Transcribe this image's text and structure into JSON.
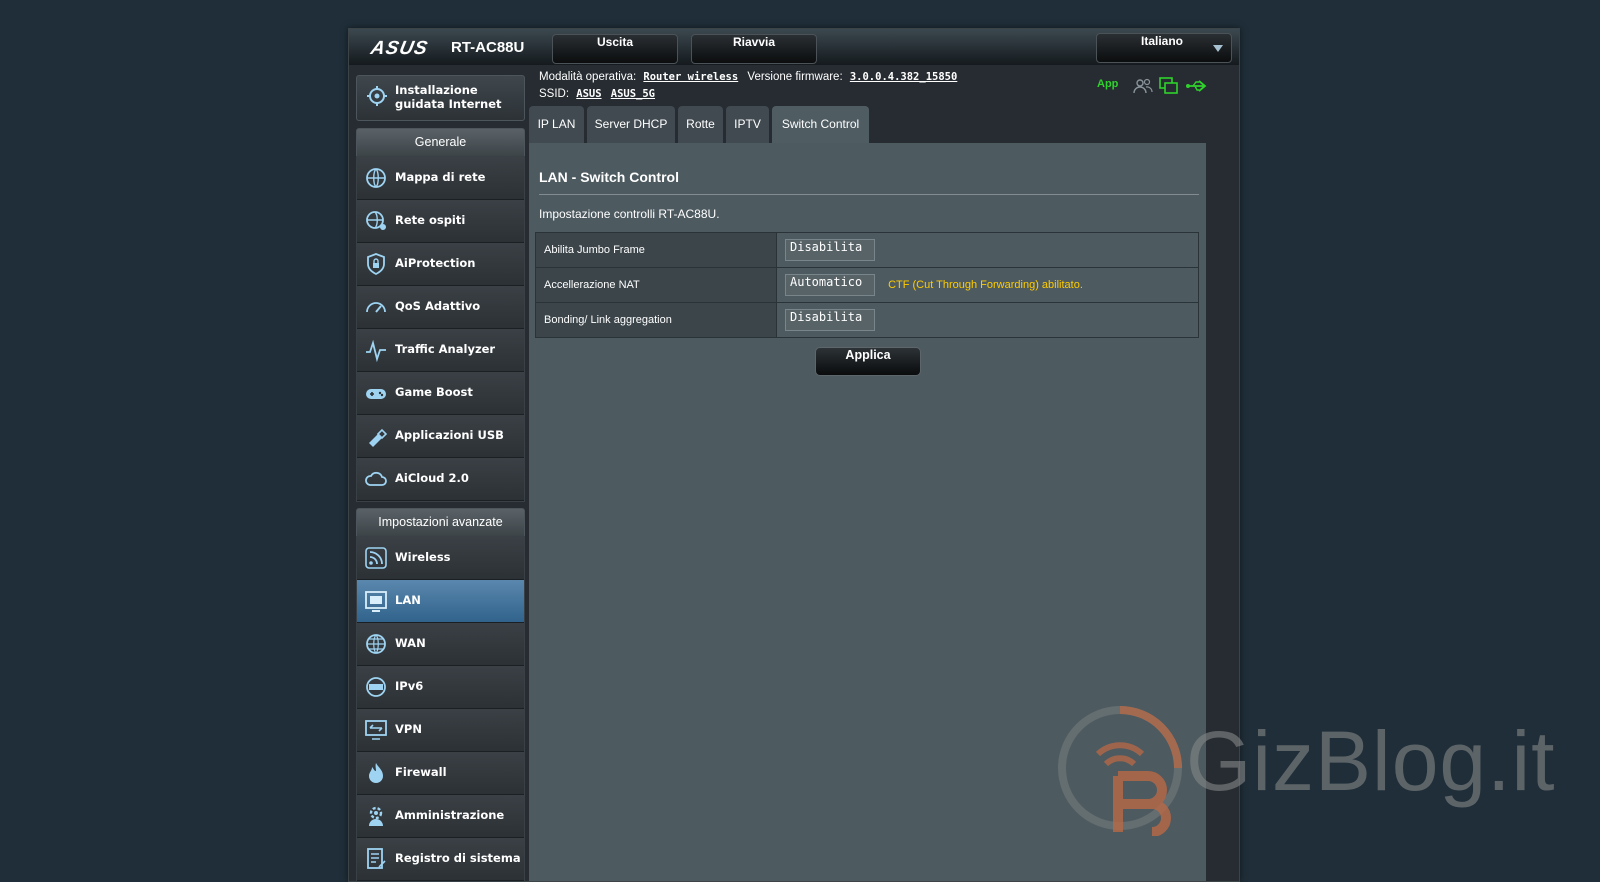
{
  "header": {
    "logo": "ASUS",
    "model": "RT-AC88U",
    "logout_label": "Uscita",
    "reboot_label": "Riavvia",
    "language": "Italiano"
  },
  "status": {
    "mode_label": "Modalità operativa:",
    "mode_value": "Router wireless",
    "firmware_label": "Versione firmware:",
    "firmware_value": "3.0.0.4.382_15850",
    "ssid_label": "SSID:",
    "ssids": [
      "ASUS",
      "ASUS_5G"
    ],
    "app_label": "App",
    "icons": [
      "clients-icon",
      "network-icon",
      "usb-icon"
    ],
    "icon_color": "#2fd22c"
  },
  "sidebar": {
    "qis_label_1": "Installazione",
    "qis_label_2": "guidata Internet",
    "general_header": "Generale",
    "general_items": [
      {
        "label": "Mappa di rete",
        "icon": "globe-network-icon"
      },
      {
        "label": "Rete ospiti",
        "icon": "guest-network-icon"
      },
      {
        "label": "AiProtection",
        "icon": "lock-shield-icon"
      },
      {
        "label": "QoS Adattivo",
        "icon": "gauge-icon"
      },
      {
        "label": "Traffic Analyzer",
        "icon": "pulse-icon"
      },
      {
        "label": "Game Boost",
        "icon": "gamepad-icon"
      },
      {
        "label": "Applicazioni USB",
        "icon": "usb-stick-icon"
      },
      {
        "label": "AiCloud 2.0",
        "icon": "cloud-icon"
      }
    ],
    "advanced_header": "Impostazioni avanzate",
    "advanced_items": [
      {
        "label": "Wireless",
        "icon": "wifi-icon"
      },
      {
        "label": "LAN",
        "icon": "lan-icon",
        "active": true
      },
      {
        "label": "WAN",
        "icon": "globe-icon"
      },
      {
        "label": "IPv6",
        "icon": "ipv6-icon"
      },
      {
        "label": "VPN",
        "icon": "vpn-icon"
      },
      {
        "label": "Firewall",
        "icon": "flame-icon"
      },
      {
        "label": "Amministrazione",
        "icon": "gear-user-icon"
      },
      {
        "label": "Registro di sistema",
        "icon": "log-icon"
      }
    ],
    "active_color": "#31638c"
  },
  "tabs": [
    {
      "label": "IP LAN"
    },
    {
      "label": "Server DHCP"
    },
    {
      "label": "Rotte"
    },
    {
      "label": "IPTV"
    },
    {
      "label": "Switch Control",
      "active": true
    }
  ],
  "content": {
    "title": "LAN - Switch Control",
    "description": "Impostazione controlli RT-AC88U.",
    "rows": [
      {
        "label": "Abilita Jumbo Frame",
        "value": "Disabilita",
        "note": ""
      },
      {
        "label": "Accellerazione NAT",
        "value": "Automatico",
        "note": "CTF (Cut Through Forwarding) abilitato."
      },
      {
        "label": "Bonding/ Link aggregation",
        "value": "Disabilita",
        "note": ""
      }
    ],
    "apply_label": "Applica",
    "note_color": "#ffcc00"
  },
  "watermark": {
    "text": "GizBlog.it"
  }
}
